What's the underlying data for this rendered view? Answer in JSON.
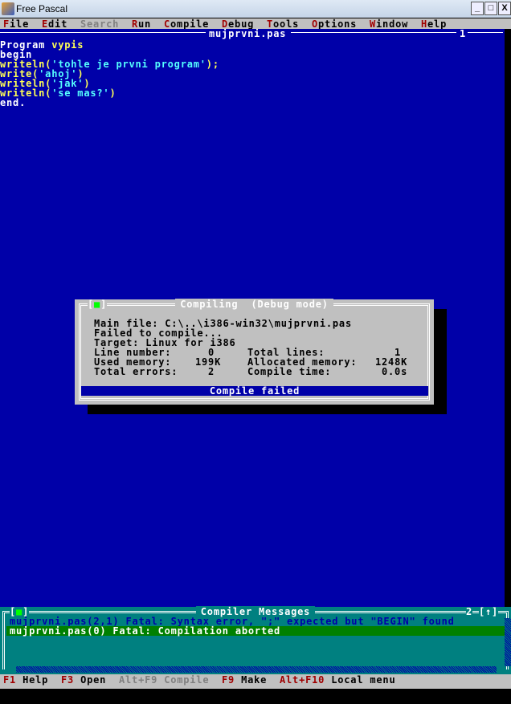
{
  "window": {
    "title": "Free Pascal",
    "minimize": "_",
    "maximize": "□",
    "close": "X"
  },
  "menu": [
    {
      "hk": "F",
      "rest": "ile"
    },
    {
      "hk": "E",
      "rest": "dit"
    },
    {
      "hk": "",
      "rest": "Search",
      "disabled": true
    },
    {
      "hk": "R",
      "rest": "un"
    },
    {
      "hk": "C",
      "rest": "ompile"
    },
    {
      "hk": "D",
      "rest": "ebug"
    },
    {
      "hk": "T",
      "rest": "ools"
    },
    {
      "hk": "O",
      "rest": "ptions"
    },
    {
      "hk": "W",
      "rest": "indow"
    },
    {
      "hk": "H",
      "rest": "elp"
    }
  ],
  "editor": {
    "filename": "mujprvni.pas",
    "window_number": "1",
    "lines": [
      {
        "a": "Program ",
        "b": "vypis",
        "c": ""
      },
      {
        "a": "begin",
        "b": "",
        "c": ""
      },
      {
        "a": "writeln(",
        "b": "'tohle je prvni program'",
        "c": ");"
      },
      {
        "a": "write(",
        "b": "'ahoj'",
        "c": ")"
      },
      {
        "a": "writeln(",
        "b": "'jak'",
        "c": ")"
      },
      {
        "a": "writeln(",
        "b": "'se mas?'",
        "c": ")"
      },
      {
        "a": "end.",
        "b": "",
        "c": ""
      }
    ]
  },
  "dialog": {
    "title": "Compiling  (Debug mode)",
    "close": "[■]",
    "main_file": "Main file: C:\\..\\i386-win32\\mujprvni.pas",
    "status_line": "Failed to compile...",
    "target": "Target: Linux for i386",
    "line_number_label": "Line number:",
    "line_number": "0",
    "total_lines_label": "Total lines:",
    "total_lines": "1",
    "used_memory_label": "Used memory:",
    "used_memory": "199K",
    "allocated_memory_label": "Allocated memory:",
    "allocated_memory": "1248K",
    "total_errors_label": "Total errors:",
    "total_errors": "2",
    "compile_time_label": "Compile time:",
    "compile_time": "0.0s",
    "result": "Compile failed"
  },
  "messages": {
    "title": "Compiler Messages",
    "close": "[■]",
    "window_number": "2",
    "zoom": "[↑]",
    "items": [
      "mujprvni.pas(2,1) Fatal: Syntax error, \";\" expected but \"BEGIN\" found",
      "mujprvni.pas(0) Fatal: Compilation aborted"
    ]
  },
  "status": [
    {
      "k": "F1",
      "l": "Help"
    },
    {
      "k": "F3",
      "l": "Open"
    },
    {
      "k": "Alt+F9",
      "l": "Compile",
      "disabled": true
    },
    {
      "k": "F9",
      "l": "Make"
    },
    {
      "k": "Alt+F10",
      "l": "Local menu"
    }
  ]
}
